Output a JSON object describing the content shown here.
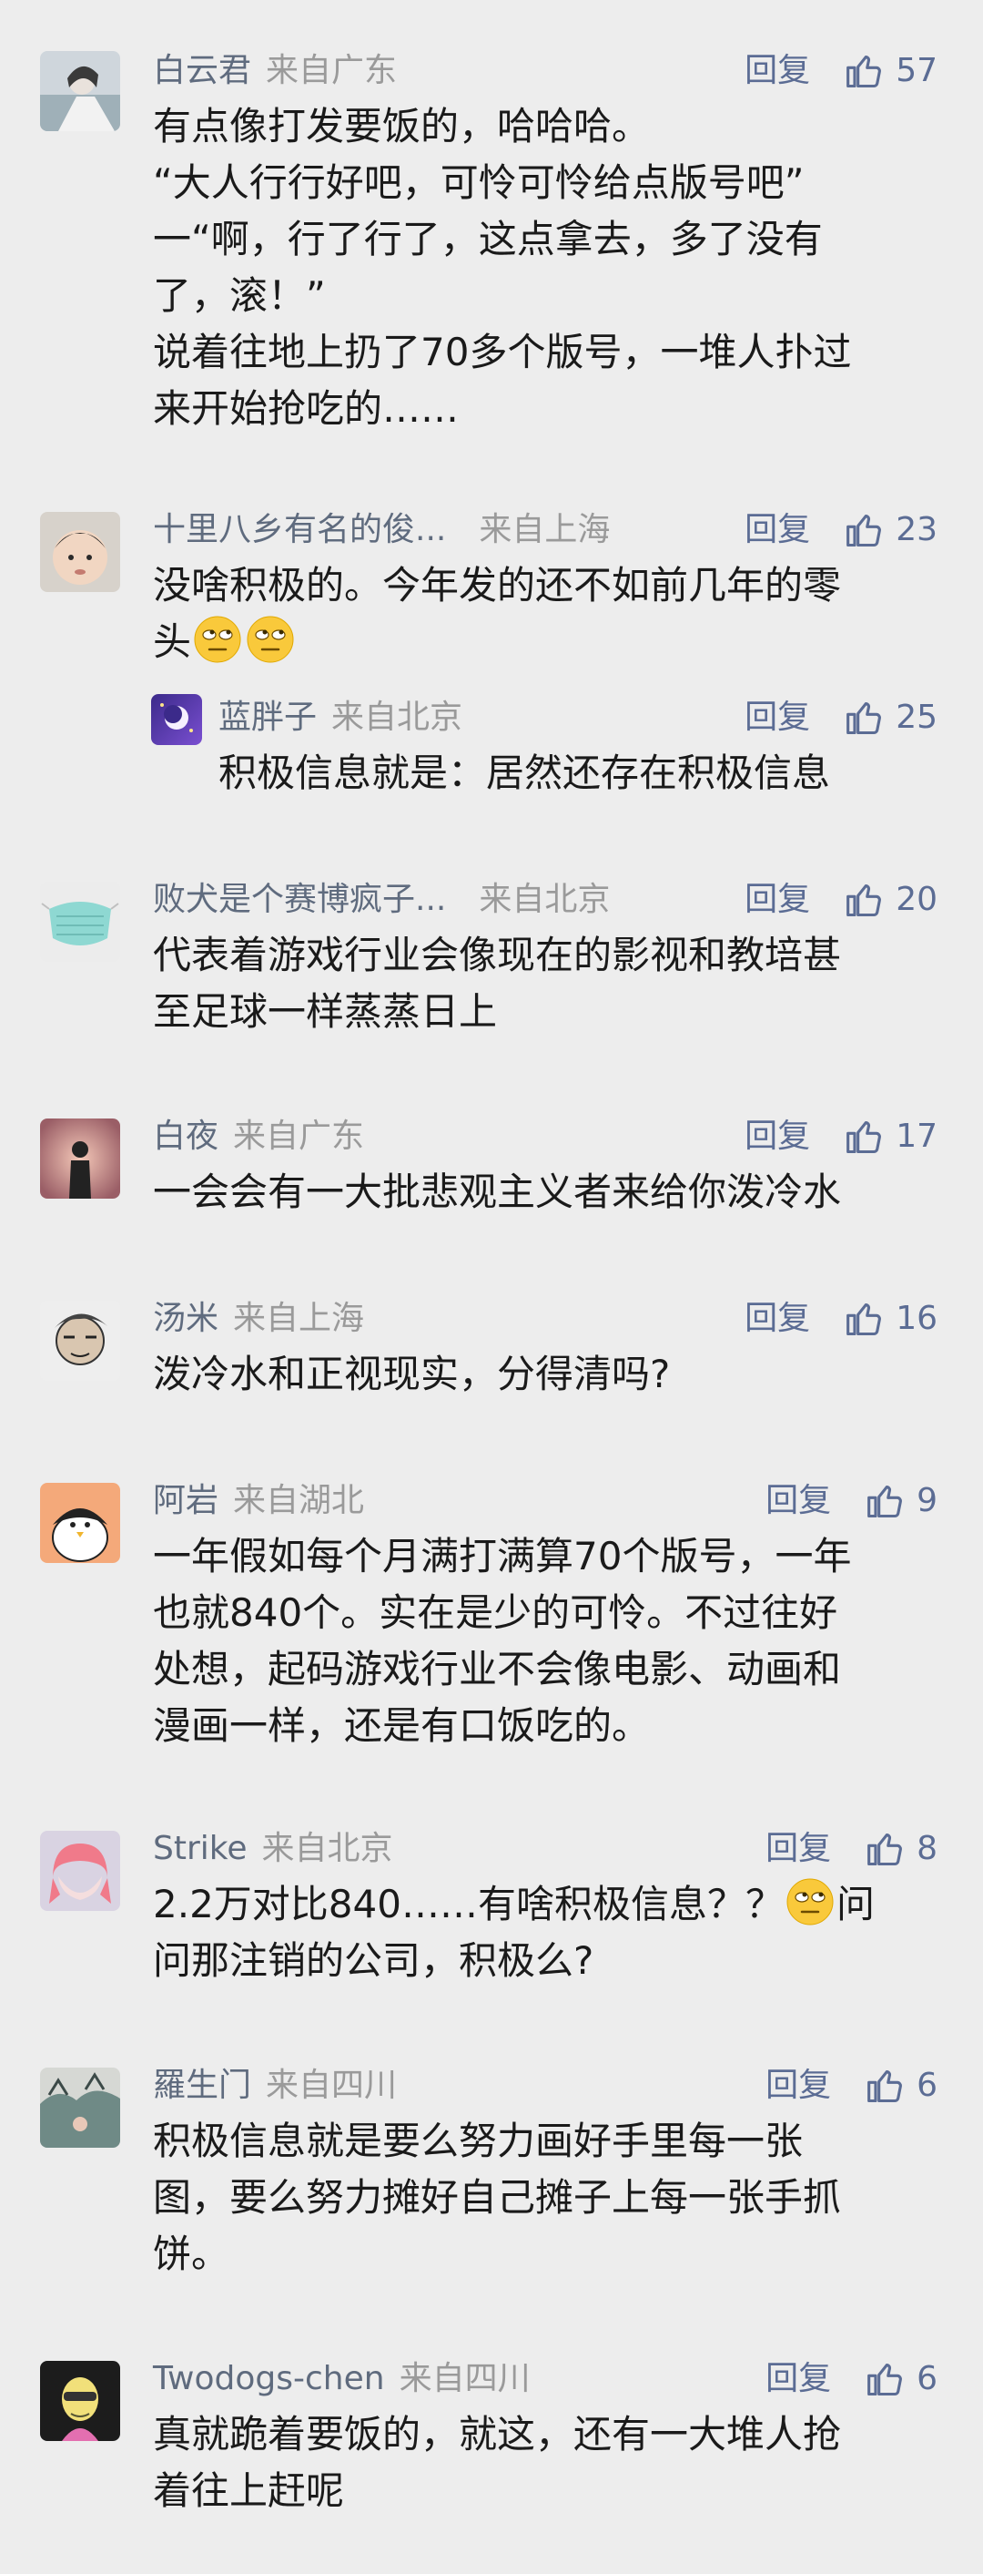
{
  "comments": [
    {
      "name": "白云君",
      "location": "来自广东",
      "reply_label": "回复",
      "likes": "57",
      "lines": [
        "有点像打发要饭的，哈哈哈。",
        "“大人行行好吧，可怜可怜给点版号吧”",
        "一“啊，行了行了，这点拿去，多了没有",
        "了，滚！”",
        "说着往地上扔了70多个版号，一堆人扑过",
        "来开始抢吃的……"
      ]
    },
    {
      "name": "十里八乡有名的俊...",
      "location": "来自上海",
      "reply_label": "回复",
      "likes": "23",
      "lines": [
        "没啥积极的。今年发的还不如前几年的零",
        "头"
      ],
      "emoji": "eye-roll-emoji",
      "reply": {
        "name": "蓝胖子",
        "location": "来自北京",
        "reply_label": "回复",
        "likes": "25",
        "lines": [
          "积极信息就是：居然还存在积极信息"
        ]
      }
    },
    {
      "name": "败犬是个赛博疯子...",
      "location": "来自北京",
      "reply_label": "回复",
      "likes": "20",
      "lines": [
        "代表着游戏行业会像现在的影视和教培甚",
        "至足球一样蒸蒸日上"
      ]
    },
    {
      "name": "白夜",
      "location": "来自广东",
      "reply_label": "回复",
      "likes": "17",
      "lines": [
        "一会会有一大批悲观主义者来给你泼冷水"
      ]
    },
    {
      "name": "汤米",
      "location": "来自上海",
      "reply_label": "回复",
      "likes": "16",
      "lines": [
        "泼冷水和正视现实，分得清吗?"
      ]
    },
    {
      "name": "阿岩",
      "location": "来自湖北",
      "reply_label": "回复",
      "likes": "9",
      "lines": [
        "一年假如每个月满打满算70个版号，一年",
        "也就840个。实在是少的可怜。不过往好",
        "处想，起码游戏行业不会像电影、动画和",
        "漫画一样，还是有口饭吃的。"
      ]
    },
    {
      "name": "Strike",
      "location": "来自北京",
      "reply_label": "回复",
      "likes": "8",
      "line1_a": "2.2万对比840……有啥积极信息？？",
      "line1_b": "问",
      "lines": [
        "问那注销的公司，积极么?"
      ]
    },
    {
      "name": "羅生门",
      "location": "来自四川",
      "reply_label": "回复",
      "likes": "6",
      "lines": [
        "积极信息就是要么努力画好手里每一张",
        "图，要么努力摊好自己摊子上每一张手抓",
        "饼。"
      ]
    },
    {
      "name": "Twodogs-chen",
      "location": "来自四川",
      "reply_label": "回复",
      "likes": "6",
      "lines": [
        "真就跪着要饭的，就这，还有一大堆人抢",
        "着往上赶呢"
      ]
    }
  ],
  "colors": {
    "background": "#ededed",
    "name": "#5f6b7e",
    "location": "#9a9a9a",
    "action": "#5b6c94",
    "text": "#1a1a1a"
  }
}
